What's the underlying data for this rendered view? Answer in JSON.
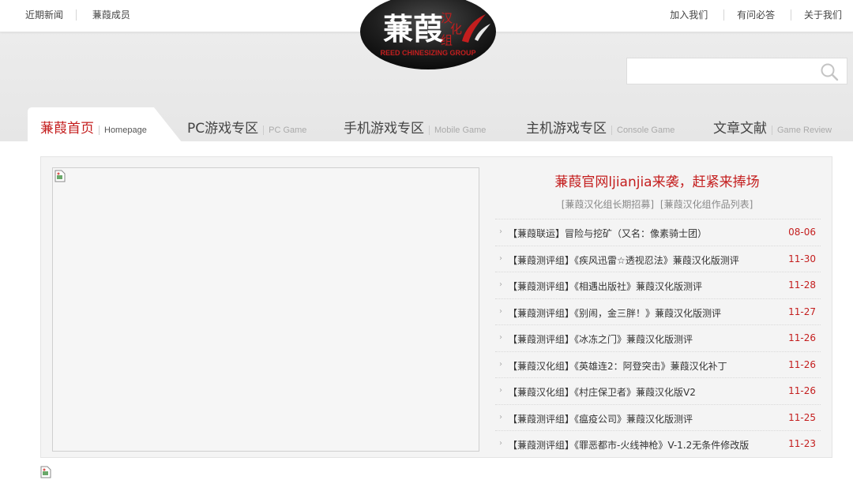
{
  "topbar": {
    "left_links": [
      "近期新闻",
      "蒹葭成员"
    ],
    "right_links": [
      "加入我们",
      "有问必答",
      "关于我们"
    ]
  },
  "logo": {
    "main": "蒹葭",
    "side": "汉化组",
    "sub": "REED CHINESIZING GROUP",
    "colors": {
      "badge": "#1e1e1e",
      "accent": "#c41e1e"
    }
  },
  "search": {
    "placeholder": "",
    "icon": "search-icon"
  },
  "nav": {
    "tabs": [
      {
        "cn": "蒹葭首页",
        "en": "Homepage",
        "active": true
      },
      {
        "cn": "PC游戏专区",
        "en": "PC Game"
      },
      {
        "cn": "手机游戏专区",
        "en": "Mobile Game"
      },
      {
        "cn": "主机游戏专区",
        "en": "Console Game"
      },
      {
        "cn": "文章文献",
        "en": "Game Review"
      }
    ]
  },
  "news": {
    "headline": "蒹葭官网ljianjia来袭，赶紧来捧场",
    "links": [
      "[蒹葭汉化组长期招募]",
      "[蒹葭汉化组作品列表]"
    ],
    "items": [
      {
        "title": "【蒹葭联运】冒险与挖矿（又名：像素骑士团）",
        "date": "08-06"
      },
      {
        "title": "【蒹葭测评组】《疾风迅雷☆透视忍法》蒹葭汉化版测评",
        "date": "11-30"
      },
      {
        "title": "【蒹葭测评组】《相遇出版社》蒹葭汉化版测评",
        "date": "11-28"
      },
      {
        "title": "【蒹葭测评组】《别闹，金三胖！》蒹葭汉化版测评",
        "date": "11-27"
      },
      {
        "title": "【蒹葭测评组】《冰冻之门》蒹葭汉化版测评",
        "date": "11-26"
      },
      {
        "title": "【蒹葭汉化组】《英雄连2：阿登突击》蒹葭汉化补丁",
        "date": "11-26"
      },
      {
        "title": "【蒹葭汉化组】《村庄保卫者》蒹葭汉化版V2",
        "date": "11-26"
      },
      {
        "title": "【蒹葭测评组】《瘟疫公司》蒹葭汉化版测评",
        "date": "11-25"
      },
      {
        "title": "【蒹葭测评组】《罪恶都市-火线神枪》V-1.2无条件修改版",
        "date": "11-23"
      }
    ]
  },
  "colors": {
    "accent": "#c41e1e",
    "band": "#e9e9e9"
  }
}
